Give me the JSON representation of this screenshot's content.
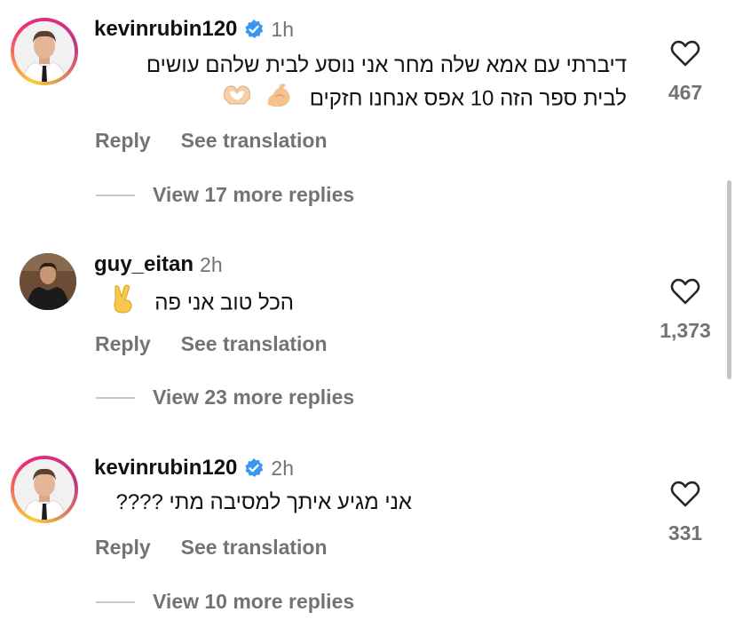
{
  "comments": [
    {
      "username": "kevinrubin120",
      "verified": true,
      "time": "1h",
      "text_lines": [
        "דיברתי עם אמא שלה מחר אני נוסע  לבית שלהם  עושים",
        "לבית ספר הזה 10 אפס אנחנו חזקים"
      ],
      "emojis": [
        "flexed-biceps",
        "heart-hands"
      ],
      "reply_label": "Reply",
      "translation_label": "See translation",
      "view_replies": "View 17 more replies",
      "likes": "467"
    },
    {
      "username": "guy_eitan",
      "verified": false,
      "time": "2h",
      "text_lines": [
        "הכל טוב אני פה"
      ],
      "emojis": [
        "victory-hand"
      ],
      "reply_label": "Reply",
      "translation_label": "See translation",
      "view_replies": "View 23 more replies",
      "likes": "1,373"
    },
    {
      "username": "kevinrubin120",
      "verified": true,
      "time": "2h",
      "text_lines": [
        "אני מגיע איתך למסיבה מתי ????"
      ],
      "emojis": [],
      "reply_label": "Reply",
      "translation_label": "See translation",
      "view_replies": "View 10 more replies",
      "likes": "331"
    }
  ],
  "colors": {
    "secondary_text": "#737373",
    "verified_badge": "#3897f0",
    "story_ring": [
      "#f9ce34",
      "#ee2a7b",
      "#c13584"
    ]
  },
  "icons": {
    "like": "heart-outline-icon",
    "verified": "verified-badge-icon"
  }
}
